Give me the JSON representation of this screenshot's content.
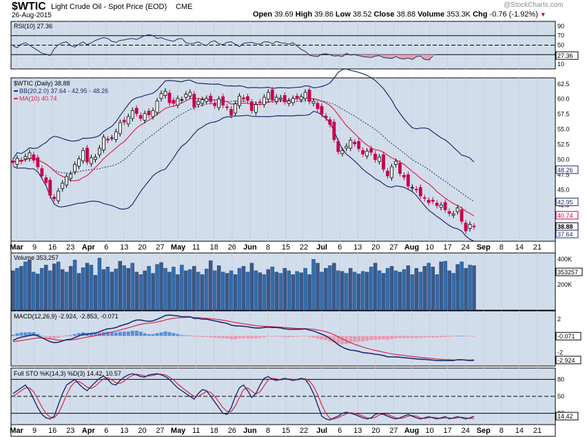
{
  "header": {
    "symbol": "$WTIC",
    "name": "Light Crude Oil - Spot Price (EOD)",
    "exchange": "CME",
    "date": "26-Aug-2015",
    "open_label": "Open",
    "open": "39.69",
    "high_label": "High",
    "high": "39.86",
    "low_label": "Low",
    "low": "38.52",
    "close_label": "Close",
    "close": "38.88",
    "volume_label": "Volume",
    "volume": "353.3K",
    "chg_label": "Chg",
    "chg": "-0.76 (-1.92%)",
    "watermark": "@StockCharts.com"
  },
  "colors": {
    "panel_bg": "#d2ddec",
    "up": "#000000",
    "down": "#c7004c",
    "ma": "#d4264a",
    "bb": "#1c2a6b",
    "volume_bar": "#2f6fae",
    "macd_hist": "#e89ab0",
    "macd_hist_pos": "#5b8fd6"
  },
  "chart_data": [
    {
      "panel": "rsi",
      "type": "line",
      "legend": "RSI(10) 27.36",
      "ylim": [
        0,
        100
      ],
      "y_ticks": [
        "90",
        "70",
        "50",
        "30",
        "10"
      ],
      "levels": [
        70,
        50,
        30
      ],
      "last_label": "27.36",
      "values": [
        48,
        45,
        52,
        55,
        50,
        44,
        39,
        33,
        31,
        28,
        42,
        51,
        55,
        57,
        49,
        46,
        52,
        57,
        51,
        55,
        60,
        63,
        66,
        64,
        58,
        56,
        60,
        61,
        63,
        64,
        62,
        66,
        70,
        72,
        70,
        64,
        66,
        62,
        60,
        58,
        63,
        64,
        55,
        53,
        54,
        57,
        52,
        49,
        57,
        59,
        53,
        51,
        56,
        57,
        52,
        47,
        54,
        55,
        56,
        53,
        52,
        57,
        57,
        53,
        58,
        55,
        54,
        52,
        55,
        48,
        41,
        37,
        29,
        27,
        26,
        31,
        32,
        30,
        27,
        28,
        26,
        33,
        29,
        30,
        28,
        26,
        25,
        24,
        27,
        28,
        24,
        23,
        22,
        26,
        22,
        21,
        23,
        20,
        26,
        27,
        20,
        19,
        27
      ]
    },
    {
      "panel": "price",
      "type": "candlestick",
      "legend": [
        "$WTIC (Daily) 38.88",
        "BB(20,2.0) 37.64 - 42.95 - 48.26",
        "MA(10) 40.74"
      ],
      "ylim": [
        36.5,
        63.5
      ],
      "y_ticks": [
        "62.5",
        "60.0",
        "57.5",
        "55.0",
        "52.5",
        "50.0",
        "47.5",
        "45.0",
        "42.5"
      ],
      "right_labels": [
        "48.26",
        "42.95",
        "40.74",
        "38.88",
        "37.64"
      ],
      "close": [
        49.5,
        50.2,
        49.7,
        50.5,
        51.1,
        49.9,
        48.8,
        47.3,
        46.2,
        44.1,
        43.5,
        44.8,
        46.1,
        47.2,
        47.6,
        49.2,
        50.1,
        51.5,
        49.6,
        50.3,
        50.4,
        51.9,
        53.7,
        53.2,
        53.6,
        54.6,
        56.1,
        56.2,
        57.1,
        58.1,
        57.6,
        56.8,
        57.6,
        57.4,
        58.1,
        59.7,
        60.9,
        61.3,
        59.4,
        59.3,
        60.1,
        59.9,
        60.8,
        61.1,
        58.7,
        59.6,
        59.9,
        60.1,
        59.6,
        58.9,
        60.0,
        59.0,
        58.6,
        57.3,
        59.2,
        60.5,
        60.0,
        59.8,
        58.1,
        59.1,
        59.4,
        60.3,
        61.1,
        59.9,
        60.3,
        60.2,
        59.6,
        59.7,
        60.1,
        60.2,
        60.4,
        61.1,
        59.6,
        59.6,
        58.4,
        57.5,
        56.9,
        55.8,
        53.3,
        51.3,
        51.5,
        52.2,
        53.2,
        52.6,
        51.8,
        50.9,
        51.4,
        51.2,
        50.0,
        50.4,
        48.4,
        47.3,
        48.8,
        49.7,
        47.7,
        47.1,
        45.6,
        45.4,
        45.0,
        44.0,
        43.6,
        42.9,
        43.1,
        42.4,
        42.5,
        41.7,
        41.1,
        41.0,
        42.0,
        39.8,
        38.2,
        39.3,
        38.9
      ],
      "ma10_label": "MA(10)",
      "bb_label": "BB(20,2.0)"
    },
    {
      "panel": "volume",
      "type": "bar",
      "legend": "Volume 353,257",
      "y_ticks": [
        "400K",
        "200K"
      ],
      "last_label": "353257",
      "values": [
        310,
        330,
        345,
        380,
        395,
        300,
        285,
        330,
        355,
        310,
        365,
        380,
        320,
        300,
        345,
        395,
        290,
        335,
        370,
        355,
        275,
        410,
        320,
        340,
        300,
        325,
        385,
        350,
        330,
        370,
        300,
        280,
        310,
        345,
        290,
        360,
        375,
        330,
        300,
        340,
        280,
        355,
        310,
        320,
        345,
        300,
        280,
        325,
        390,
        310,
        350,
        300,
        290,
        310,
        280,
        330,
        345,
        300,
        370,
        310,
        295,
        280,
        320,
        340,
        300,
        290,
        330,
        310,
        280,
        305,
        295,
        330,
        280,
        400,
        370,
        300,
        330,
        350,
        370,
        310,
        305,
        290,
        330,
        300,
        285,
        305,
        300,
        340,
        370,
        310,
        290,
        330,
        345,
        310,
        300,
        320,
        350,
        280,
        330,
        300,
        345,
        370,
        340,
        280,
        380,
        385,
        310,
        290,
        360,
        380,
        330,
        355,
        350
      ]
    },
    {
      "panel": "macd",
      "type": "line",
      "legend": "MACD(12,26,9) -2.924, -2.853, -0.071",
      "ylim": [
        -3.6,
        3.0
      ],
      "y_ticks": [
        "2",
        "0",
        "-2"
      ],
      "right_labels": [
        "-0.071",
        "-2.924"
      ],
      "macd": [
        -0.55,
        -0.3,
        -0.15,
        -0.05,
        0.05,
        0.15,
        0.0,
        -0.2,
        -0.45,
        -0.7,
        -0.8,
        -0.75,
        -0.6,
        -0.45,
        -0.4,
        -0.2,
        0.0,
        0.2,
        0.2,
        0.3,
        0.35,
        0.5,
        0.7,
        0.85,
        0.9,
        1.0,
        1.2,
        1.35,
        1.5,
        1.75,
        1.9,
        1.9,
        1.8,
        1.75,
        1.8,
        2.0,
        2.2,
        2.45,
        2.5,
        2.45,
        2.4,
        2.3,
        2.3,
        2.3,
        2.1,
        2.1,
        2.0,
        2.0,
        1.9,
        1.8,
        1.7,
        1.6,
        1.5,
        1.3,
        1.2,
        1.2,
        1.15,
        1.1,
        1.0,
        0.95,
        0.95,
        1.0,
        1.05,
        1.0,
        1.0,
        0.95,
        0.85,
        0.8,
        0.8,
        0.8,
        0.8,
        0.85,
        0.7,
        0.6,
        0.4,
        0.2,
        0.0,
        -0.3,
        -0.65,
        -1.05,
        -1.35,
        -1.55,
        -1.7,
        -1.75,
        -1.85,
        -2.0,
        -2.05,
        -2.1,
        -2.2,
        -2.25,
        -2.35,
        -2.5,
        -2.5,
        -2.5,
        -2.55,
        -2.6,
        -2.65,
        -2.7,
        -2.75,
        -2.8,
        -2.8,
        -2.85,
        -2.9,
        -2.95,
        -2.95,
        -2.95,
        -2.95,
        -2.95,
        -2.85,
        -2.85,
        -2.9,
        -2.95,
        -2.924
      ],
      "signal": [
        -0.7,
        -0.62,
        -0.55,
        -0.47,
        -0.4,
        -0.3,
        -0.25,
        -0.24,
        -0.28,
        -0.36,
        -0.44,
        -0.5,
        -0.52,
        -0.5,
        -0.48,
        -0.42,
        -0.34,
        -0.23,
        -0.15,
        -0.06,
        0.02,
        0.12,
        0.24,
        0.36,
        0.47,
        0.58,
        0.71,
        0.84,
        0.97,
        1.12,
        1.27,
        1.39,
        1.47,
        1.53,
        1.58,
        1.67,
        1.77,
        1.91,
        2.03,
        2.11,
        2.17,
        2.2,
        2.22,
        2.24,
        2.21,
        2.19,
        2.15,
        2.12,
        2.07,
        2.02,
        1.95,
        1.88,
        1.8,
        1.7,
        1.6,
        1.52,
        1.45,
        1.38,
        1.3,
        1.23,
        1.18,
        1.15,
        1.13,
        1.1,
        1.08,
        1.05,
        1.01,
        0.97,
        0.93,
        0.9,
        0.88,
        0.87,
        0.84,
        0.8,
        0.72,
        0.62,
        0.5,
        0.34,
        0.14,
        -0.1,
        -0.35,
        -0.59,
        -0.81,
        -1.0,
        -1.17,
        -1.34,
        -1.48,
        -1.61,
        -1.73,
        -1.83,
        -1.94,
        -2.05,
        -2.14,
        -2.21,
        -2.28,
        -2.34,
        -2.4,
        -2.46,
        -2.52,
        -2.57,
        -2.62,
        -2.67,
        -2.71,
        -2.76,
        -2.8,
        -2.83,
        -2.85,
        -2.87,
        -2.87,
        -2.87,
        -2.87,
        -2.88,
        -2.853
      ]
    },
    {
      "panel": "stoch",
      "type": "line",
      "legend": "Full STO %K(14,3) %D(3) 14.42, 10.57",
      "ylim": [
        0,
        100
      ],
      "y_ticks": [
        "80",
        "50",
        "20"
      ],
      "levels": [
        80,
        50,
        20
      ],
      "right_labels": [
        "14.42"
      ],
      "k": [
        55,
        60,
        65,
        70,
        60,
        45,
        30,
        18,
        12,
        10,
        15,
        35,
        55,
        70,
        75,
        80,
        72,
        65,
        60,
        68,
        75,
        82,
        86,
        80,
        72,
        70,
        78,
        84,
        88,
        90,
        88,
        85,
        84,
        88,
        89,
        90,
        88,
        85,
        80,
        72,
        65,
        60,
        55,
        50,
        45,
        55,
        62,
        60,
        50,
        40,
        30,
        20,
        18,
        30,
        50,
        65,
        70,
        60,
        48,
        55,
        70,
        82,
        85,
        80,
        78,
        80,
        82,
        80,
        78,
        80,
        82,
        80,
        70,
        55,
        35,
        15,
        10,
        8,
        12,
        15,
        20,
        22,
        20,
        18,
        15,
        12,
        10,
        12,
        18,
        20,
        18,
        15,
        12,
        10,
        12,
        15,
        18,
        15,
        12,
        10,
        12,
        14,
        12,
        10,
        12,
        14,
        10,
        12,
        14,
        12,
        10,
        12,
        14.42
      ],
      "d": [
        50,
        55,
        60,
        65,
        65,
        58,
        45,
        31,
        20,
        13,
        12,
        20,
        35,
        53,
        67,
        75,
        76,
        72,
        66,
        64,
        68,
        75,
        81,
        83,
        79,
        74,
        73,
        77,
        83,
        87,
        89,
        88,
        86,
        86,
        87,
        89,
        89,
        88,
        84,
        79,
        72,
        66,
        60,
        55,
        50,
        50,
        54,
        59,
        57,
        50,
        40,
        30,
        23,
        23,
        33,
        48,
        62,
        65,
        59,
        54,
        58,
        69,
        79,
        82,
        81,
        79,
        80,
        81,
        80,
        79,
        80,
        81,
        77,
        68,
        53,
        35,
        20,
        11,
        10,
        12,
        16,
        19,
        21,
        20,
        18,
        15,
        12,
        11,
        13,
        17,
        19,
        18,
        15,
        12,
        11,
        12,
        15,
        16,
        15,
        12,
        11,
        12,
        13,
        12,
        11,
        12,
        12,
        11,
        12,
        13,
        12,
        11,
        10.57
      ]
    }
  ],
  "x_axis": {
    "labels": [
      "Mar",
      "9",
      "16",
      "23",
      "Apr",
      "6",
      "13",
      "20",
      "27",
      "May",
      "11",
      "18",
      "26",
      "Jun",
      "8",
      "15",
      "22",
      "Jul",
      "6",
      "13",
      "20",
      "27",
      "Aug",
      "10",
      "17",
      "24",
      "Sep",
      "8",
      "14",
      "21"
    ],
    "bold": [
      "Mar",
      "Apr",
      "May",
      "Jun",
      "Jul",
      "Aug",
      "Sep"
    ]
  }
}
